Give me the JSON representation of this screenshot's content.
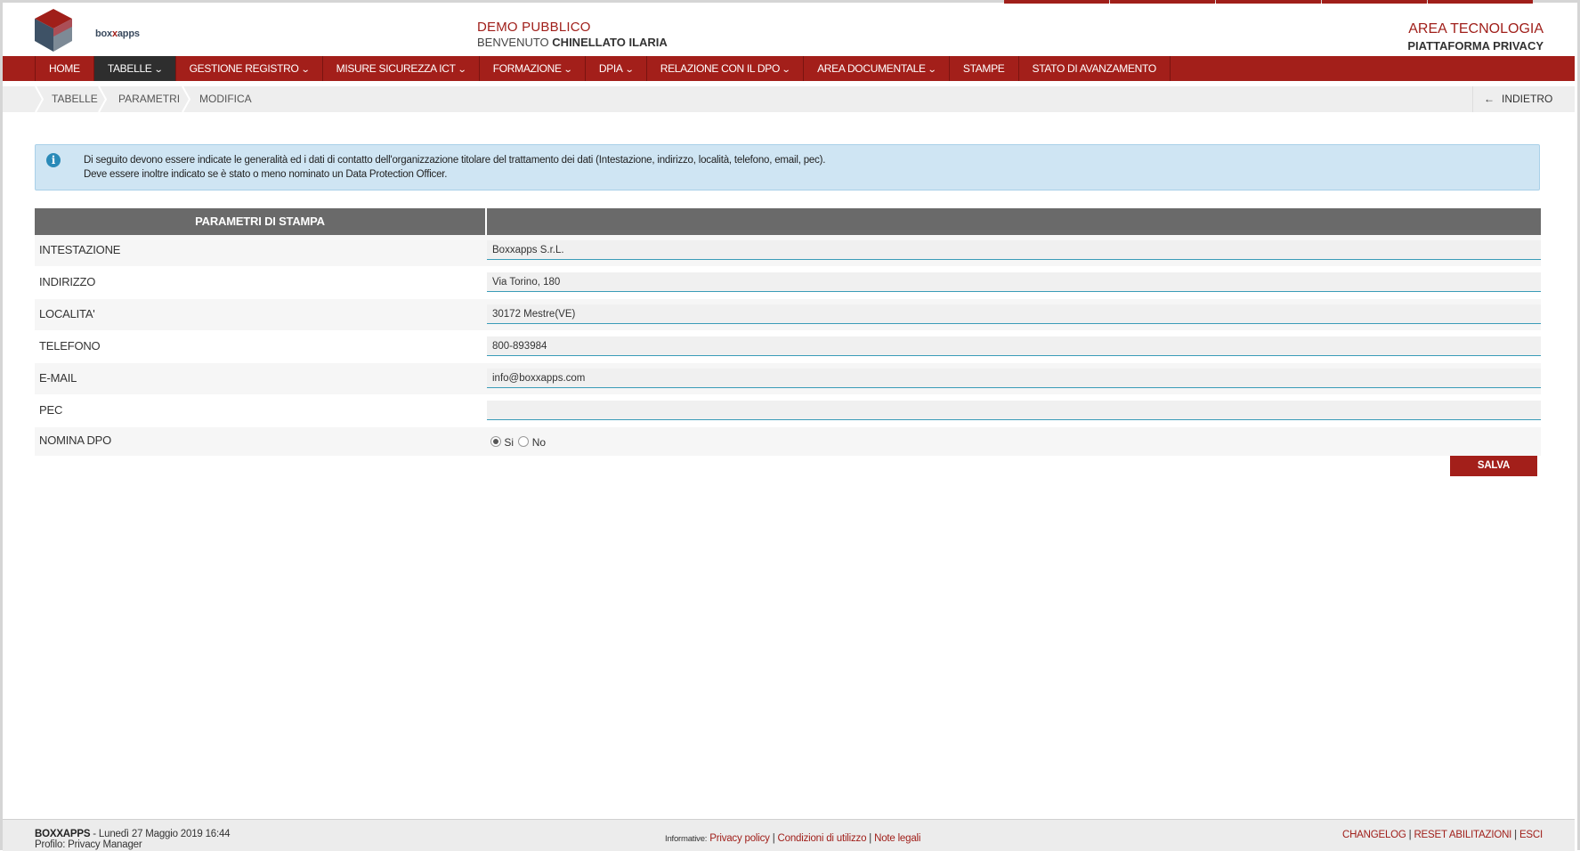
{
  "header": {
    "logo_text_pre": "box",
    "logo_text_mid": "x",
    "logo_text_post": "apps",
    "demo_title": "DEMO PUBBLICO",
    "welcome_prefix": "BENVENUTO",
    "user_name": "CHINELLATO ILARIA",
    "area_title": "AREA TECNOLOGIA",
    "platform_title": "PIATTAFORMA PRIVACY"
  },
  "nav": {
    "home": "HOME",
    "tabelle": "TABELLE",
    "gestione_registro": "GESTIONE REGISTRO",
    "misure_sicurezza": "MISURE SICUREZZA ICT",
    "formazione": "FORMAZIONE",
    "dpia": "DPIA",
    "relazione_dpo": "RELAZIONE CON IL DPO",
    "area_documentale": "AREA DOCUMENTALE",
    "stampe": "STAMPE",
    "stato_avanzamento": "STATO DI AVANZAMENTO"
  },
  "breadcrumb": {
    "items": [
      "TABELLE",
      "PARAMETRI",
      "MODIFICA"
    ],
    "back_label": "INDIETRO"
  },
  "info": {
    "line1": "Di seguito devono essere indicate le generalità ed i dati di contatto dell'organizzazione titolare del trattamento dei dati (Intestazione, indirizzo, località, telefono, email, pec).",
    "line2": "Deve essere inoltre indicato se è stato o meno nominato un Data Protection Officer."
  },
  "form": {
    "header": "PARAMETRI DI STAMPA",
    "rows": [
      {
        "label": "INTESTAZIONE",
        "value": "Boxxapps S.r.L."
      },
      {
        "label": "INDIRIZZO",
        "value": "Via Torino, 180"
      },
      {
        "label": "LOCALITA'",
        "value": "30172 Mestre(VE)"
      },
      {
        "label": "TELEFONO",
        "value": "800-893984"
      },
      {
        "label": "E-MAIL",
        "value": "info@boxxapps.com"
      },
      {
        "label": "PEC",
        "value": ""
      }
    ],
    "dpo_label": "NOMINA DPO",
    "dpo_yes": "Si",
    "dpo_no": "No",
    "dpo_selected": "Si",
    "save_label": "SALVA"
  },
  "footer": {
    "company": "BOXXAPPS",
    "datetime": " - Lunedì 27 Maggio 2019 16:44",
    "profile": "Profilo: Privacy Manager",
    "info_label": "Informative:",
    "privacy": "Privacy policy",
    "conditions": "Condizioni di utilizzo",
    "legal": "Note legali",
    "changelog": "CHANGELOG",
    "reset": "RESET ABILITAZIONI",
    "exit": "ESCI"
  },
  "colors": {
    "brand_red": "#a31f1a",
    "dark_nav": "#2e2e2e",
    "info_bg": "#cfe5f3",
    "field_underline": "#3a9cb8"
  }
}
